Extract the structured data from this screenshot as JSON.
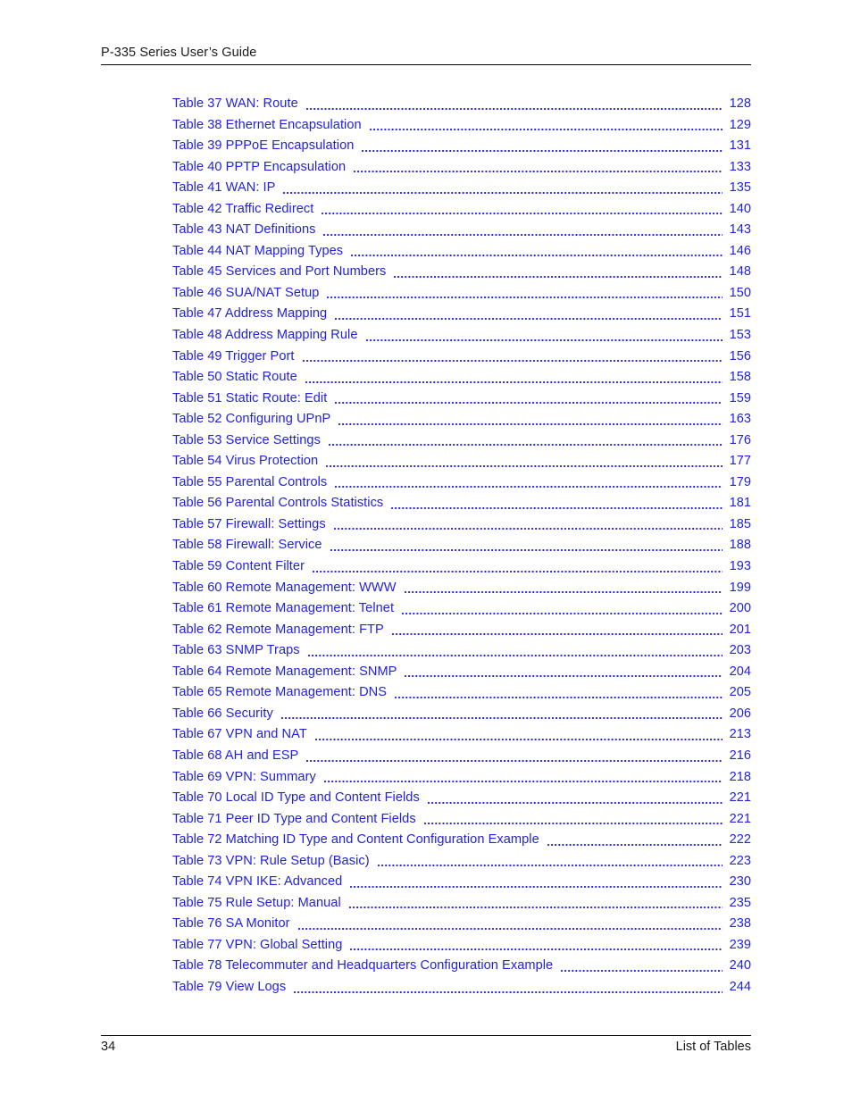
{
  "header": {
    "title": "P-335 Series User’s Guide"
  },
  "footer": {
    "page_number": "34",
    "section": "List of Tables"
  },
  "colors": {
    "link": "#2222dd",
    "text": "#1a1a1a",
    "rule": "#000000",
    "background": "#ffffff"
  },
  "toc": {
    "entries": [
      {
        "label": "Table 37 WAN: Route",
        "page": "128"
      },
      {
        "label": "Table 38 Ethernet Encapsulation",
        "page": "129"
      },
      {
        "label": "Table 39 PPPoE Encapsulation",
        "page": "131"
      },
      {
        "label": "Table 40 PPTP Encapsulation",
        "page": "133"
      },
      {
        "label": "Table 41 WAN: IP",
        "page": "135"
      },
      {
        "label": "Table 42 Traffic Redirect",
        "page": "140"
      },
      {
        "label": "Table 43 NAT Definitions",
        "page": "143"
      },
      {
        "label": "Table 44 NAT Mapping Types",
        "page": "146"
      },
      {
        "label": "Table 45 Services and Port Numbers",
        "page": "148"
      },
      {
        "label": "Table 46 SUA/NAT Setup",
        "page": "150"
      },
      {
        "label": "Table 47 Address Mapping",
        "page": "151"
      },
      {
        "label": "Table 48 Address Mapping Rule",
        "page": "153"
      },
      {
        "label": "Table 49 Trigger Port",
        "page": "156"
      },
      {
        "label": "Table 50 Static Route",
        "page": "158"
      },
      {
        "label": "Table 51 Static Route: Edit",
        "page": "159"
      },
      {
        "label": "Table 52 Configuring UPnP",
        "page": "163"
      },
      {
        "label": "Table 53 Service Settings",
        "page": "176"
      },
      {
        "label": "Table 54 Virus Protection",
        "page": "177"
      },
      {
        "label": "Table 55 Parental Controls",
        "page": "179"
      },
      {
        "label": "Table 56 Parental Controls Statistics",
        "page": "181"
      },
      {
        "label": "Table 57 Firewall: Settings",
        "page": "185"
      },
      {
        "label": "Table 58 Firewall: Service",
        "page": "188"
      },
      {
        "label": "Table 59 Content Filter",
        "page": "193"
      },
      {
        "label": "Table 60 Remote Management: WWW",
        "page": "199"
      },
      {
        "label": "Table 61 Remote Management: Telnet",
        "page": "200"
      },
      {
        "label": "Table 62 Remote Management: FTP",
        "page": "201"
      },
      {
        "label": "Table 63 SNMP Traps",
        "page": "203"
      },
      {
        "label": "Table 64 Remote Management: SNMP",
        "page": "204"
      },
      {
        "label": "Table 65 Remote Management: DNS",
        "page": "205"
      },
      {
        "label": "Table 66 Security",
        "page": "206"
      },
      {
        "label": "Table 67 VPN and NAT",
        "page": "213"
      },
      {
        "label": "Table 68 AH and ESP",
        "page": "216"
      },
      {
        "label": "Table 69 VPN: Summary",
        "page": "218"
      },
      {
        "label": "Table 70 Local ID Type and Content Fields",
        "page": "221"
      },
      {
        "label": "Table 71 Peer ID Type and Content Fields",
        "page": "221"
      },
      {
        "label": "Table 72 Matching ID Type and Content Configuration Example",
        "page": "222"
      },
      {
        "label": "Table 73 VPN: Rule Setup (Basic)",
        "page": "223"
      },
      {
        "label": "Table 74 VPN IKE: Advanced",
        "page": "230"
      },
      {
        "label": "Table 75 Rule Setup: Manual",
        "page": "235"
      },
      {
        "label": "Table 76 SA Monitor",
        "page": "238"
      },
      {
        "label": "Table 77 VPN: Global Setting",
        "page": "239"
      },
      {
        "label": "Table 78 Telecommuter and Headquarters Configuration Example",
        "page": "240"
      },
      {
        "label": "Table 79 View Logs",
        "page": "244"
      }
    ]
  }
}
